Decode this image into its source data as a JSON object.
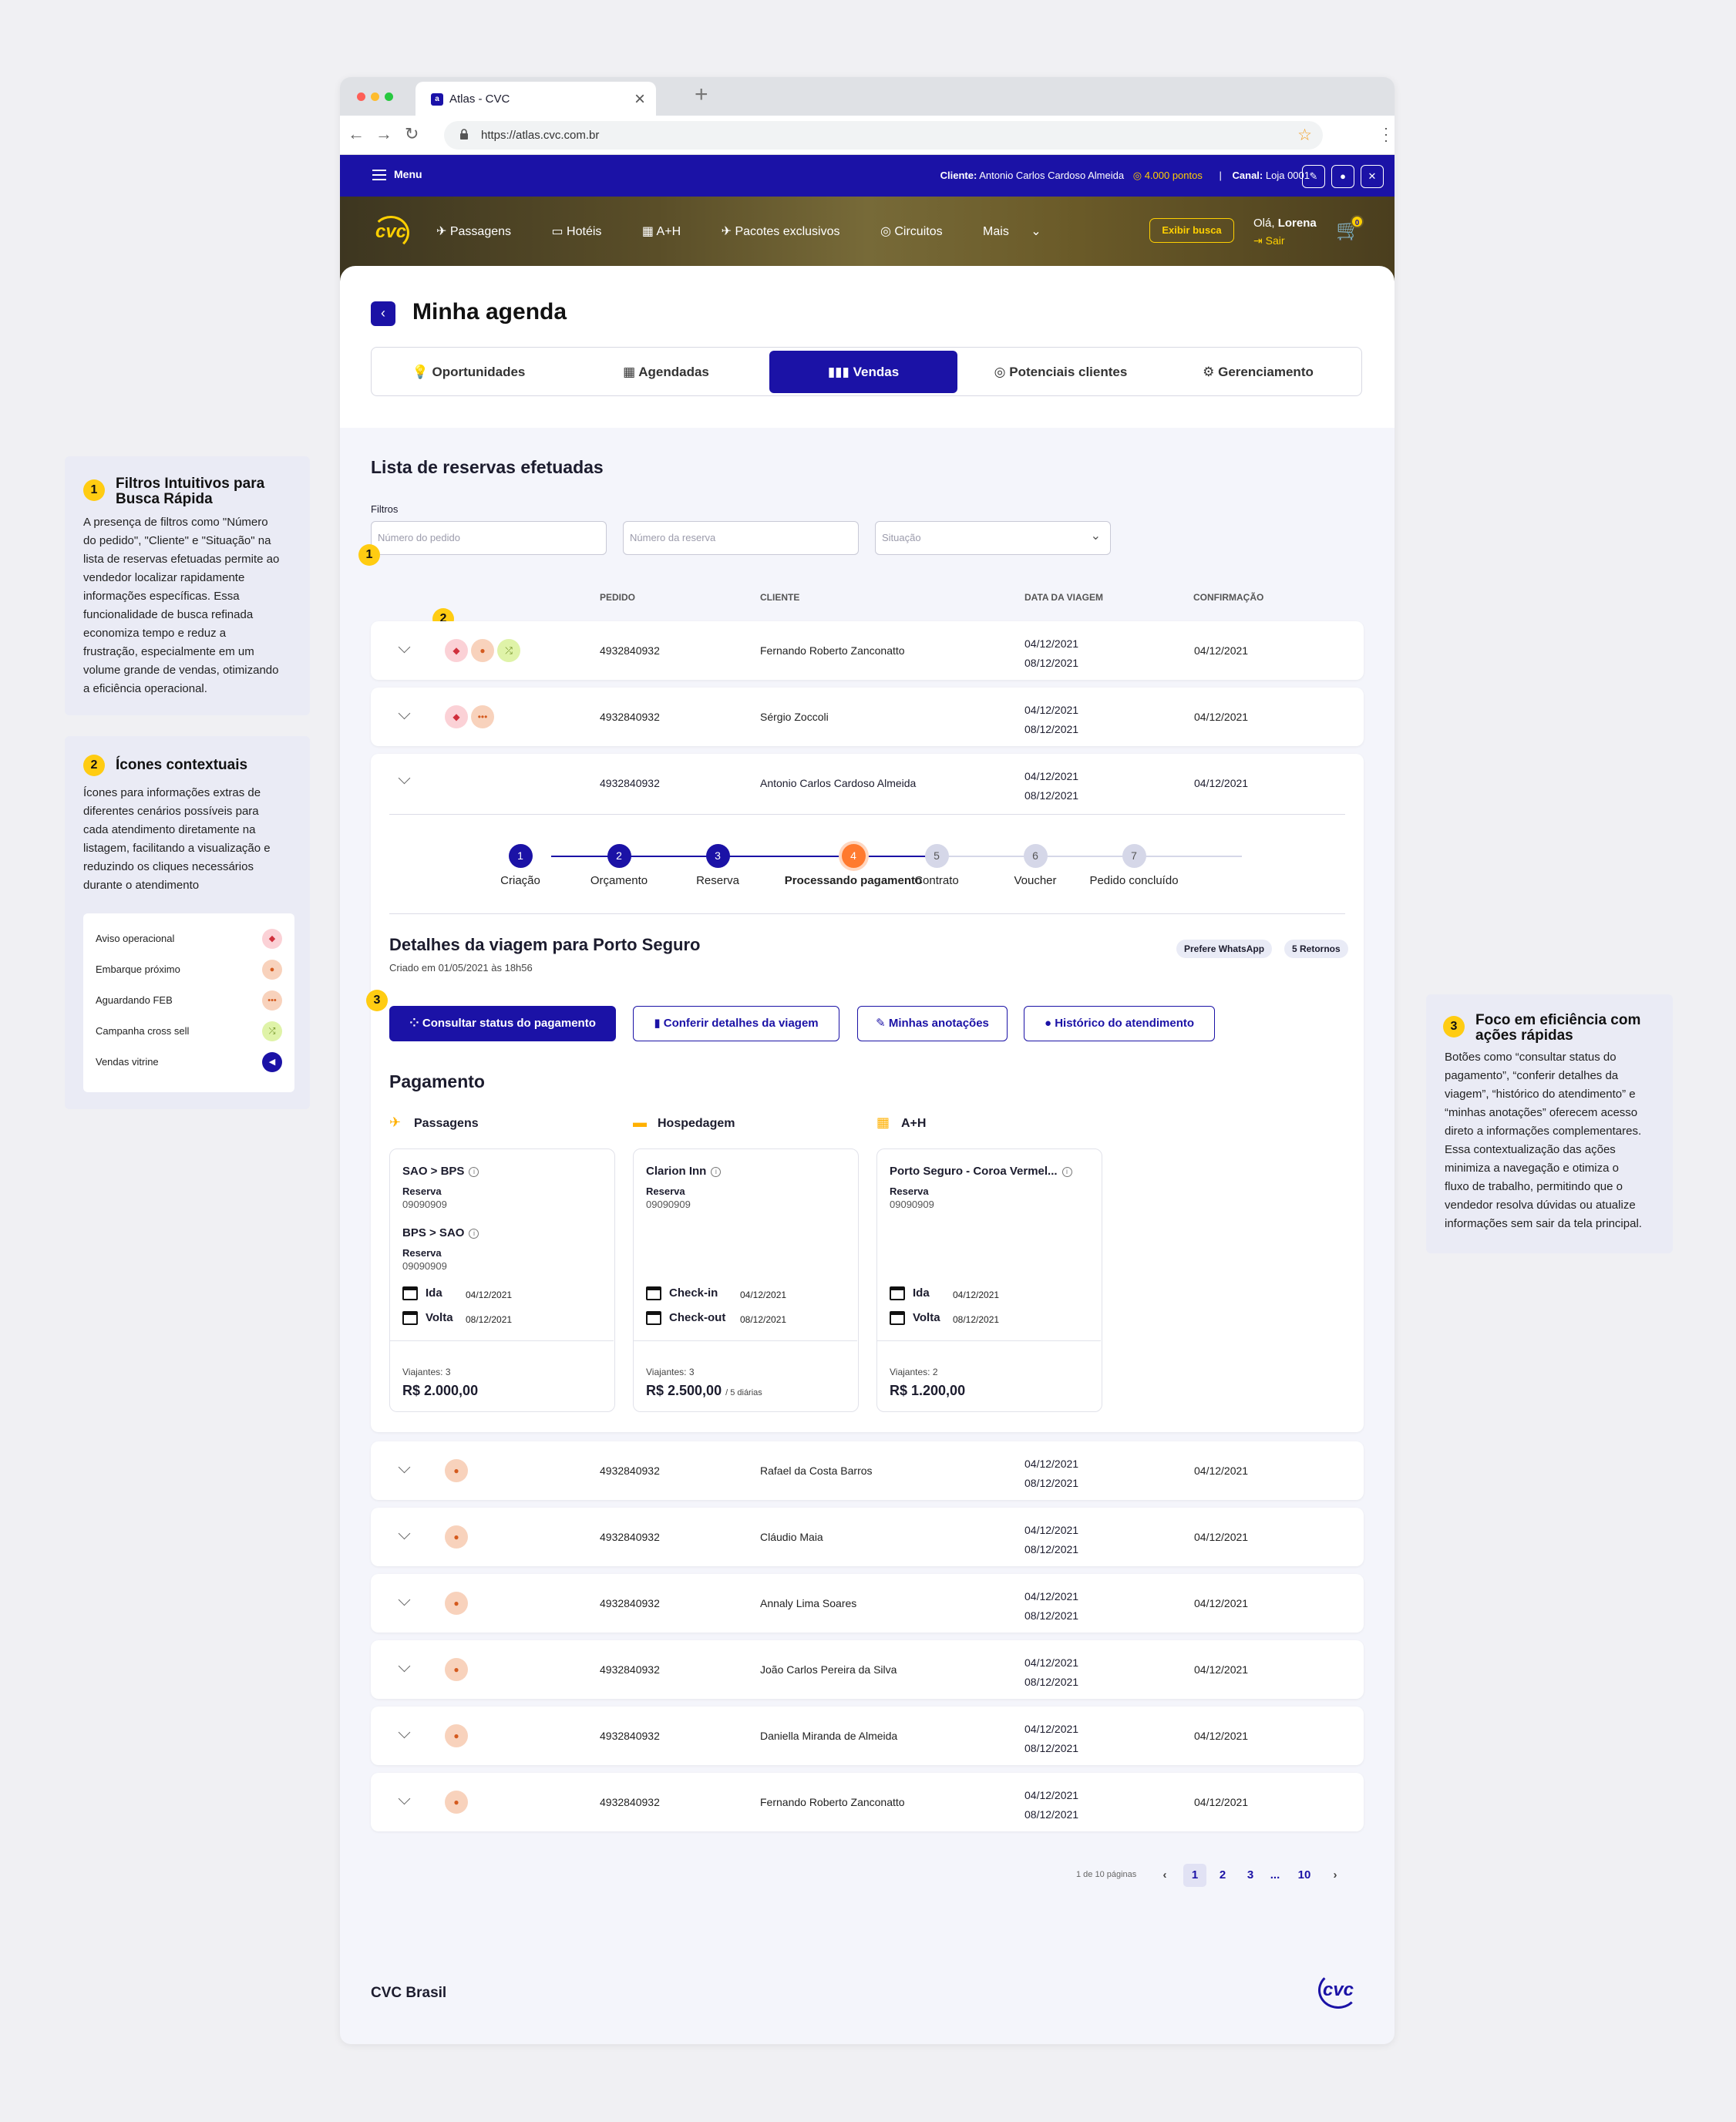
{
  "browser": {
    "tab_title": "Atlas - CVC",
    "url": "https://atlas.cvc.com.br"
  },
  "topbar": {
    "menu_label": "Menu",
    "client_label": "Cliente:",
    "client_name": "Antonio Carlos Cardoso Almeida",
    "points": "4.000 pontos",
    "channel_label": "Canal:",
    "channel_value": "Loja 0001"
  },
  "hero": {
    "logo": "cvc",
    "nav": [
      "Passagens",
      "Hotéis",
      "A+H",
      "Pacotes exclusivos",
      "Circuitos",
      "Mais"
    ],
    "search_button": "Exibir busca",
    "greeting": "Olá,",
    "user": "Lorena",
    "logout": "Sair",
    "cart_count": "0"
  },
  "page": {
    "title": "Minha agenda",
    "tabs": [
      "Oportunidades",
      "Agendadas",
      "Vendas",
      "Potenciais clientes",
      "Gerenciamento"
    ],
    "active_tab": "Vendas"
  },
  "list": {
    "title": "Lista de reservas efetuadas",
    "filters_label": "Filtros",
    "filter_placeholders": [
      "Número do pedido",
      "Número da reserva",
      "Situação"
    ],
    "columns": [
      "PEDIDO",
      "CLIENTE",
      "DATA DA VIAGEM",
      "CONFIRMAÇÃO"
    ],
    "rows": [
      {
        "pedido": "4932840932",
        "cliente": "Fernando Roberto Zanconatto",
        "ida": "04/12/2021",
        "volta": "08/12/2021",
        "confirmacao": "04/12/2021",
        "icons": [
          "aviso-operacional",
          "embarque-proximo",
          "campanha-cross-sell"
        ]
      },
      {
        "pedido": "4932840932",
        "cliente": "Sérgio Zoccoli",
        "ida": "04/12/2021",
        "volta": "08/12/2021",
        "confirmacao": "04/12/2021",
        "icons": [
          "aviso-operacional",
          "aguardando-feb"
        ]
      },
      {
        "pedido": "4932840932",
        "cliente": "Antonio Carlos Cardoso Almeida",
        "ida": "04/12/2021",
        "volta": "08/12/2021",
        "confirmacao": "04/12/2021",
        "icons": []
      },
      {
        "pedido": "4932840932",
        "cliente": "Rafael da Costa Barros",
        "ida": "04/12/2021",
        "volta": "08/12/2021",
        "confirmacao": "04/12/2021",
        "icons": [
          "embarque-proximo"
        ]
      },
      {
        "pedido": "4932840932",
        "cliente": "Cláudio Maia",
        "ida": "04/12/2021",
        "volta": "08/12/2021",
        "confirmacao": "04/12/2021",
        "icons": [
          "embarque-proximo"
        ]
      },
      {
        "pedido": "4932840932",
        "cliente": "Annaly Lima Soares",
        "ida": "04/12/2021",
        "volta": "08/12/2021",
        "confirmacao": "04/12/2021",
        "icons": [
          "embarque-proximo"
        ]
      },
      {
        "pedido": "4932840932",
        "cliente": "João Carlos Pereira da Silva",
        "ida": "04/12/2021",
        "volta": "08/12/2021",
        "confirmacao": "04/12/2021",
        "icons": [
          "embarque-proximo"
        ]
      },
      {
        "pedido": "4932840932",
        "cliente": "Daniella Miranda de Almeida",
        "ida": "04/12/2021",
        "volta": "08/12/2021",
        "confirmacao": "04/12/2021",
        "icons": [
          "embarque-proximo"
        ]
      },
      {
        "pedido": "4932840932",
        "cliente": "Fernando Roberto Zanconatto",
        "ida": "04/12/2021",
        "volta": "08/12/2021",
        "confirmacao": "04/12/2021",
        "icons": [
          "embarque-proximo"
        ]
      }
    ]
  },
  "expanded": {
    "steps": [
      {
        "n": "1",
        "label": "Criação",
        "state": "done"
      },
      {
        "n": "2",
        "label": "Orçamento",
        "state": "done"
      },
      {
        "n": "3",
        "label": "Reserva",
        "state": "done"
      },
      {
        "n": "4",
        "label": "Processando pagamento",
        "state": "current"
      },
      {
        "n": "5",
        "label": "Contrato",
        "state": "pending"
      },
      {
        "n": "6",
        "label": "Voucher",
        "state": "pending"
      },
      {
        "n": "7",
        "label": "Pedido concluído",
        "state": "pending"
      }
    ],
    "title": "Detalhes da viagem para Porto Seguro",
    "created": "Criado em 01/05/2021 às 18h56",
    "pills": [
      "Prefere WhatsApp",
      "5 Retornos"
    ],
    "actions": [
      "Consultar status do pagamento",
      "Conferir detalhes da viagem",
      "Minhas anotações",
      "Histórico do atendimento"
    ],
    "payment_title": "Pagamento",
    "sections": [
      "Passagens",
      "Hospedagem",
      "A+H"
    ],
    "cards": {
      "passagens": {
        "route1": "SAO > BPS",
        "route2": "BPS > SAO",
        "res_label": "Reserva",
        "res1": "09090909",
        "res2": "09090909",
        "ida_label": "Ida",
        "ida": "04/12/2021",
        "volta_label": "Volta",
        "volta": "08/12/2021",
        "viajantes": "Viajantes: 3",
        "price": "R$ 2.000,00"
      },
      "hospedagem": {
        "hotel": "Clarion Inn",
        "res_label": "Reserva",
        "res": "09090909",
        "in_label": "Check-in",
        "checkin": "04/12/2021",
        "out_label": "Check-out",
        "checkout": "08/12/2021",
        "viajantes": "Viajantes: 3",
        "price": "R$ 2.500,00",
        "per": "/ 5 diárias"
      },
      "ah": {
        "name": "Porto Seguro - Coroa Vermel...",
        "res_label": "Reserva",
        "res": "09090909",
        "ida_label": "Ida",
        "ida": "04/12/2021",
        "volta_label": "Volta",
        "volta": "08/12/2021",
        "viajantes": "Viajantes: 2",
        "price": "R$ 1.200,00"
      }
    }
  },
  "pagination": {
    "info": "1 de 10 páginas",
    "pages": [
      "1",
      "2",
      "3",
      "...",
      "10"
    ],
    "prev": "‹",
    "next": "›"
  },
  "footer": {
    "title": "CVC Brasil",
    "logo": "cvc"
  },
  "annotations": {
    "a1": {
      "n": "1",
      "title": "Filtros Intuitivos para Busca Rápida",
      "text": [
        "A presença de filtros como \"Número",
        "do pedido\", \"Cliente\" e \"Situação\" na",
        "lista de reservas efetuadas permite ao",
        "vendedor localizar rapidamente",
        "informações específicas. Essa",
        "funcionalidade de busca refinada",
        "economiza tempo e reduz a",
        "frustração, especialmente em um",
        "volume grande de vendas, otimizando",
        "a eficiência operacional."
      ]
    },
    "a2": {
      "n": "2",
      "title": "Ícones contextuais",
      "text": [
        "Ícones para informações extras de",
        "diferentes cenários possíveis para",
        "cada atendimento diretamente na",
        "listagem, facilitando a visualização e",
        "reduzindo os cliques necessários",
        "durante o atendimento"
      ],
      "legend": [
        "Aviso operacional",
        "Embarque próximo",
        "Aguardando FEB",
        "Campanha cross sell",
        "Vendas vitrine"
      ]
    },
    "a3": {
      "n": "3",
      "title": "Foco em eficiência com ações rápidas",
      "text": [
        "Botões como “consultar status do",
        "pagamento”, “conferir detalhes da",
        "viagem”, “histórico do atendimento” e",
        "“minhas anotações” oferecem acesso",
        "direto a informações complementares.",
        "Essa contextualização das ações",
        "minimiza a navegação e otimiza o",
        "fluxo de trabalho, permitindo que o",
        "vendedor resolva dúvidas ou atualize",
        "informações sem sair da tela principal."
      ]
    }
  },
  "colors": {
    "primary": "#1b12a6",
    "accent": "#ffd000",
    "current_step": "#ff7a2f"
  }
}
